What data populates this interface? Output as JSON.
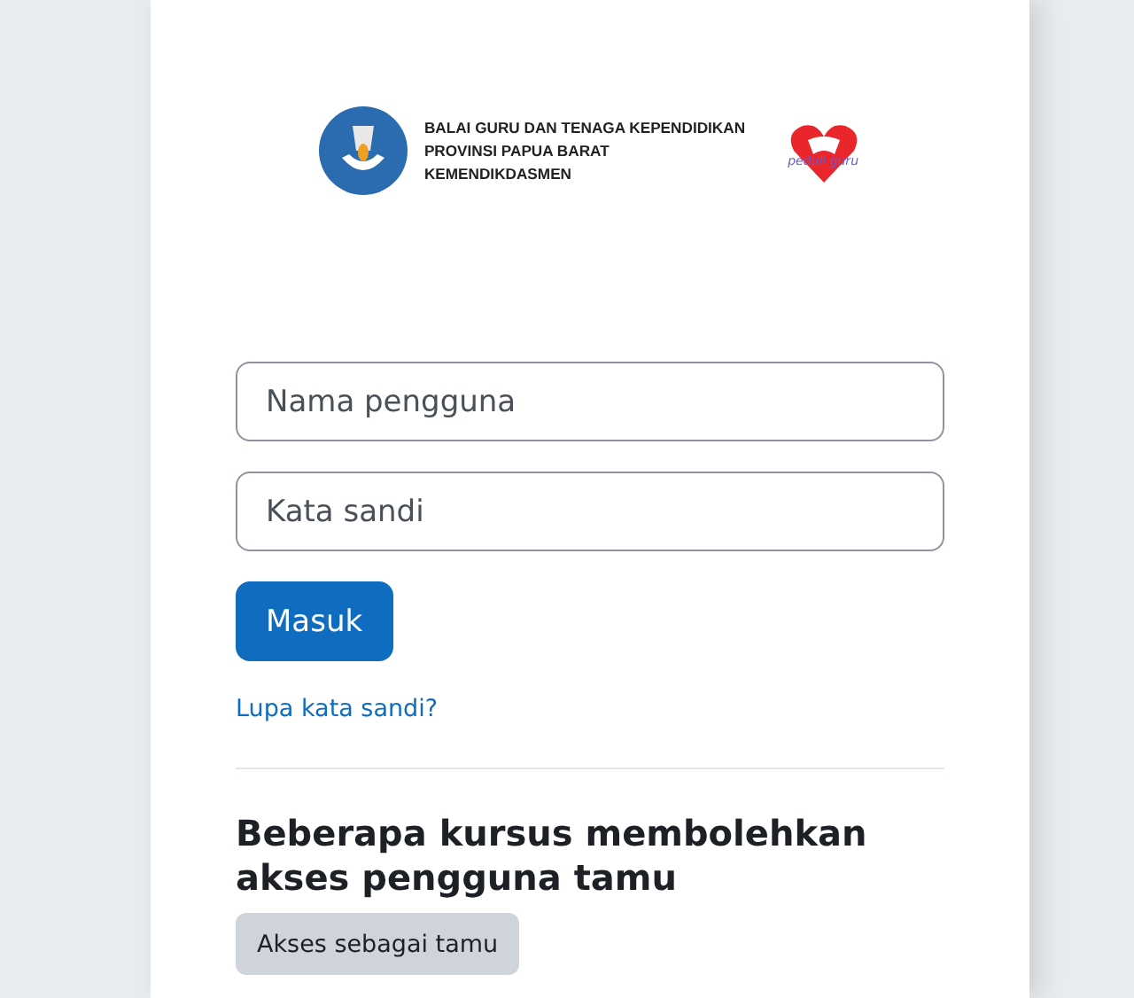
{
  "header": {
    "institution_lines": [
      "BALAI GURU DAN TENAGA KEPENDIDIKAN",
      "PROVINSI PAPUA BARAT",
      "KEMENDIKDASMEN"
    ],
    "partner_logo_text": "peduli guru"
  },
  "login_form": {
    "username": {
      "placeholder": "Nama pengguna"
    },
    "password": {
      "placeholder": "Kata sandi"
    },
    "submit": "Masuk",
    "forgot_link": "Lupa kata sandi?"
  },
  "guest": {
    "heading": "Beberapa kursus membolehkan akses pengguna tamu",
    "button": "Akses sebagai tamu"
  }
}
